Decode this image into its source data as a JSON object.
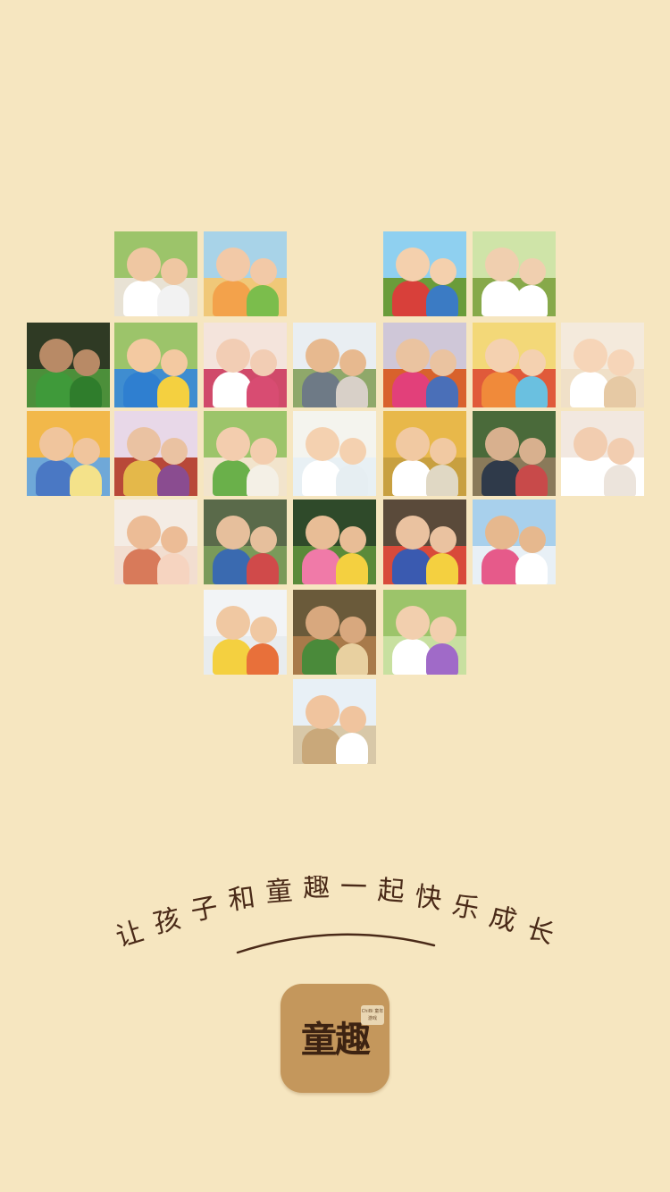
{
  "slogan": {
    "text": "让孩子和童趣一起快乐成长",
    "chars": [
      "让",
      "孩",
      "子",
      "和",
      "童",
      "趣",
      "一",
      "起",
      "快",
      "乐",
      "成",
      "长"
    ],
    "color": "#4a2a18"
  },
  "app": {
    "name": "童趣",
    "badge": "ChiBi 童年游戏"
  },
  "photos": [
    {
      "name": "photo-father-daughter",
      "sky": "#9cc46a",
      "ground": "#e8e2d4",
      "skin": "#efc7a2",
      "shirt_a": "#ffffff",
      "shirt_b": "#f2f2f2"
    },
    {
      "name": "photo-kids-group-smiling",
      "sky": "#a8d3e8",
      "ground": "#f0c878",
      "skin": "#f2c9a7",
      "shirt_a": "#f3a24b",
      "shirt_b": "#7bbd4c"
    },
    {
      "name": "photo-kids-lying-grass",
      "sky": "#8fd0f0",
      "ground": "#6a9c3a",
      "skin": "#f4d0ad",
      "shirt_a": "#d8403a",
      "shirt_b": "#3b7bc4"
    },
    {
      "name": "photo-kids-jumping-field",
      "sky": "#cfe4a8",
      "ground": "#87a94a",
      "skin": "#f0cfaf",
      "shirt_a": "#ffffff",
      "shirt_b": "#ffffff"
    },
    {
      "name": "photo-kids-green-shirts",
      "sky": "#2f3a24",
      "ground": "#4c8f3a",
      "skin": "#b88a66",
      "shirt_a": "#3f9a3a",
      "shirt_b": "#2f7d2c"
    },
    {
      "name": "photo-boy-yellow-cap",
      "sky": "#9cc46a",
      "ground": "#3f8dd0",
      "skin": "#f3c9a1",
      "shirt_a": "#2f7fd0",
      "shirt_b": "#f4d040"
    },
    {
      "name": "photo-mother-daughter",
      "sky": "#f4e4dc",
      "ground": "#d04a6a",
      "skin": "#f2cdb4",
      "shirt_a": "#ffffff",
      "shirt_b": "#d84c72"
    },
    {
      "name": "photo-child-lifted-air",
      "sky": "#e9eef2",
      "ground": "#8fa86a",
      "skin": "#e7b98f",
      "shirt_a": "#6e7a86",
      "shirt_b": "#d8d0c8"
    },
    {
      "name": "photo-kids-market-stall",
      "sky": "#cfc7d8",
      "ground": "#d8622c",
      "skin": "#eac3a0",
      "shirt_a": "#e2407a",
      "shirt_b": "#4a6fb8"
    },
    {
      "name": "photo-kids-circle-faces",
      "sky": "#f3d878",
      "ground": "#e05a3a",
      "skin": "#f4d1b0",
      "shirt_a": "#f08a3a",
      "shirt_b": "#6ac0e0"
    },
    {
      "name": "photo-mother-girl-hug",
      "sky": "#f4eadc",
      "ground": "#f0e0c8",
      "skin": "#f6d5b8",
      "shirt_a": "#ffffff",
      "shirt_b": "#e6c9a4"
    },
    {
      "name": "photo-father-son-play",
      "sky": "#f2b84a",
      "ground": "#6fa8d8",
      "skin": "#f0c59d",
      "shirt_a": "#4a78c4",
      "shirt_b": "#f4e28a"
    },
    {
      "name": "photo-kids-crafts-party",
      "sky": "#e8d8e8",
      "ground": "#b84838",
      "skin": "#eac2a2",
      "shirt_a": "#e4b84a",
      "shirt_b": "#8a4c90"
    },
    {
      "name": "photo-mother-reading-kids",
      "sky": "#9cc46a",
      "ground": "#f2e4cc",
      "skin": "#f3cdae",
      "shirt_a": "#6ab04a",
      "shirt_b": "#f4f0e6"
    },
    {
      "name": "photo-boy-smiling-outdoors",
      "sky": "#f4f4ee",
      "ground": "#e8f0f4",
      "skin": "#f4d1b0",
      "shirt_a": "#ffffff",
      "shirt_b": "#e6eef2"
    },
    {
      "name": "photo-toddler-walking",
      "sky": "#e8b84a",
      "ground": "#c8a040",
      "skin": "#f1c9a2",
      "shirt_a": "#ffffff",
      "shirt_b": "#e0d8c4"
    },
    {
      "name": "photo-kids-bamboo-forest",
      "sky": "#4a6a3a",
      "ground": "#8a7a5a",
      "skin": "#d8b08e",
      "shirt_a": "#2f3a4a",
      "shirt_b": "#c84a4a"
    },
    {
      "name": "photo-father-daughter-hug",
      "sky": "#f2e8e0",
      "ground": "#ffffff",
      "skin": "#f2cdb0",
      "shirt_a": "#ffffff",
      "shirt_b": "#ece4dc"
    },
    {
      "name": "photo-mother-daughter-faces",
      "sky": "#f4ece4",
      "ground": "#f2ded0",
      "skin": "#ecbc96",
      "shirt_a": "#d87a5a",
      "shirt_b": "#f6d4c0"
    },
    {
      "name": "photo-kids-park-tug",
      "sky": "#5a6a4a",
      "ground": "#7a9a5a",
      "skin": "#e6bf9c",
      "shirt_a": "#3a6ab0",
      "shirt_b": "#d04a4a"
    },
    {
      "name": "photo-girl-jumping-park",
      "sky": "#2f4a2a",
      "ground": "#5a8a3a",
      "skin": "#e8bd96",
      "shirt_a": "#f07aa8",
      "shirt_b": "#f4d040"
    },
    {
      "name": "photo-kids-painting-table",
      "sky": "#5a4a3a",
      "ground": "#d84a3a",
      "skin": "#eac2a0",
      "shirt_a": "#3a5ab0",
      "shirt_b": "#f4d040"
    },
    {
      "name": "photo-father-shoulders-girl",
      "sky": "#a8d0ec",
      "ground": "#e8f0f6",
      "skin": "#e6b88e",
      "shirt_a": "#e65a8a",
      "shirt_b": "#ffffff"
    },
    {
      "name": "photo-girl-basketball",
      "sky": "#f2f4f6",
      "ground": "#e8ecee",
      "skin": "#f0c8a2",
      "shirt_a": "#f4d040",
      "shirt_b": "#e8703a"
    },
    {
      "name": "photo-family-pottery",
      "sky": "#6a5a3a",
      "ground": "#a87a4a",
      "skin": "#d8a87e",
      "shirt_a": "#4a8a3a",
      "shirt_b": "#e8d0a0"
    },
    {
      "name": "photo-mother-hugs-girl",
      "sky": "#9cc46a",
      "ground": "#c8e0a0",
      "skin": "#f2cfae",
      "shirt_a": "#ffffff",
      "shirt_b": "#a06ac8"
    },
    {
      "name": "photo-mother-daughter-laugh",
      "sky": "#e8f0f6",
      "ground": "#d8c8a8",
      "skin": "#f0c49e",
      "shirt_a": "#c9a87a",
      "shirt_b": "#ffffff"
    }
  ]
}
